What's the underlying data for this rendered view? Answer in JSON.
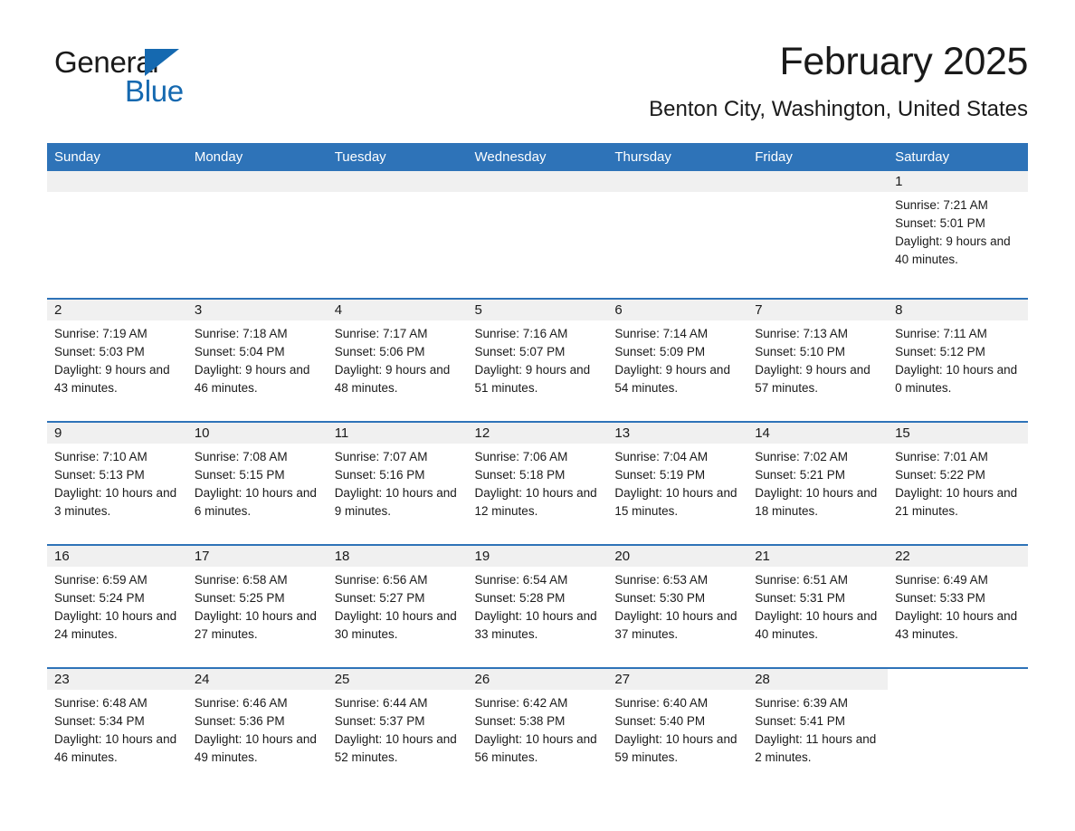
{
  "logo": {
    "word1": "General",
    "word2": "Blue",
    "triangle_color": "#1569b0",
    "text_color": "#1a1a1a"
  },
  "header": {
    "title": "February 2025",
    "location": "Benton City, Washington, United States"
  },
  "theme": {
    "header_blue": "#2e73b8",
    "day_band_gray": "#f0f0f0",
    "text": "#1a1a1a"
  },
  "weekday_headers": [
    "Sunday",
    "Monday",
    "Tuesday",
    "Wednesday",
    "Thursday",
    "Friday",
    "Saturday"
  ],
  "weeks": [
    [
      {
        "day": "",
        "sunrise": "",
        "sunset": "",
        "daylight": "",
        "blank": true
      },
      {
        "day": "",
        "sunrise": "",
        "sunset": "",
        "daylight": "",
        "blank": true
      },
      {
        "day": "",
        "sunrise": "",
        "sunset": "",
        "daylight": "",
        "blank": true
      },
      {
        "day": "",
        "sunrise": "",
        "sunset": "",
        "daylight": "",
        "blank": true
      },
      {
        "day": "",
        "sunrise": "",
        "sunset": "",
        "daylight": "",
        "blank": true
      },
      {
        "day": "",
        "sunrise": "",
        "sunset": "",
        "daylight": "",
        "blank": true
      },
      {
        "day": "1",
        "sunrise": "Sunrise: 7:21 AM",
        "sunset": "Sunset: 5:01 PM",
        "daylight": "Daylight: 9 hours and 40 minutes.",
        "blank": false
      }
    ],
    [
      {
        "day": "2",
        "sunrise": "Sunrise: 7:19 AM",
        "sunset": "Sunset: 5:03 PM",
        "daylight": "Daylight: 9 hours and 43 minutes.",
        "blank": false
      },
      {
        "day": "3",
        "sunrise": "Sunrise: 7:18 AM",
        "sunset": "Sunset: 5:04 PM",
        "daylight": "Daylight: 9 hours and 46 minutes.",
        "blank": false
      },
      {
        "day": "4",
        "sunrise": "Sunrise: 7:17 AM",
        "sunset": "Sunset: 5:06 PM",
        "daylight": "Daylight: 9 hours and 48 minutes.",
        "blank": false
      },
      {
        "day": "5",
        "sunrise": "Sunrise: 7:16 AM",
        "sunset": "Sunset: 5:07 PM",
        "daylight": "Daylight: 9 hours and 51 minutes.",
        "blank": false
      },
      {
        "day": "6",
        "sunrise": "Sunrise: 7:14 AM",
        "sunset": "Sunset: 5:09 PM",
        "daylight": "Daylight: 9 hours and 54 minutes.",
        "blank": false
      },
      {
        "day": "7",
        "sunrise": "Sunrise: 7:13 AM",
        "sunset": "Sunset: 5:10 PM",
        "daylight": "Daylight: 9 hours and 57 minutes.",
        "blank": false
      },
      {
        "day": "8",
        "sunrise": "Sunrise: 7:11 AM",
        "sunset": "Sunset: 5:12 PM",
        "daylight": "Daylight: 10 hours and 0 minutes.",
        "blank": false
      }
    ],
    [
      {
        "day": "9",
        "sunrise": "Sunrise: 7:10 AM",
        "sunset": "Sunset: 5:13 PM",
        "daylight": "Daylight: 10 hours and 3 minutes.",
        "blank": false
      },
      {
        "day": "10",
        "sunrise": "Sunrise: 7:08 AM",
        "sunset": "Sunset: 5:15 PM",
        "daylight": "Daylight: 10 hours and 6 minutes.",
        "blank": false
      },
      {
        "day": "11",
        "sunrise": "Sunrise: 7:07 AM",
        "sunset": "Sunset: 5:16 PM",
        "daylight": "Daylight: 10 hours and 9 minutes.",
        "blank": false
      },
      {
        "day": "12",
        "sunrise": "Sunrise: 7:06 AM",
        "sunset": "Sunset: 5:18 PM",
        "daylight": "Daylight: 10 hours and 12 minutes.",
        "blank": false
      },
      {
        "day": "13",
        "sunrise": "Sunrise: 7:04 AM",
        "sunset": "Sunset: 5:19 PM",
        "daylight": "Daylight: 10 hours and 15 minutes.",
        "blank": false
      },
      {
        "day": "14",
        "sunrise": "Sunrise: 7:02 AM",
        "sunset": "Sunset: 5:21 PM",
        "daylight": "Daylight: 10 hours and 18 minutes.",
        "blank": false
      },
      {
        "day": "15",
        "sunrise": "Sunrise: 7:01 AM",
        "sunset": "Sunset: 5:22 PM",
        "daylight": "Daylight: 10 hours and 21 minutes.",
        "blank": false
      }
    ],
    [
      {
        "day": "16",
        "sunrise": "Sunrise: 6:59 AM",
        "sunset": "Sunset: 5:24 PM",
        "daylight": "Daylight: 10 hours and 24 minutes.",
        "blank": false
      },
      {
        "day": "17",
        "sunrise": "Sunrise: 6:58 AM",
        "sunset": "Sunset: 5:25 PM",
        "daylight": "Daylight: 10 hours and 27 minutes.",
        "blank": false
      },
      {
        "day": "18",
        "sunrise": "Sunrise: 6:56 AM",
        "sunset": "Sunset: 5:27 PM",
        "daylight": "Daylight: 10 hours and 30 minutes.",
        "blank": false
      },
      {
        "day": "19",
        "sunrise": "Sunrise: 6:54 AM",
        "sunset": "Sunset: 5:28 PM",
        "daylight": "Daylight: 10 hours and 33 minutes.",
        "blank": false
      },
      {
        "day": "20",
        "sunrise": "Sunrise: 6:53 AM",
        "sunset": "Sunset: 5:30 PM",
        "daylight": "Daylight: 10 hours and 37 minutes.",
        "blank": false
      },
      {
        "day": "21",
        "sunrise": "Sunrise: 6:51 AM",
        "sunset": "Sunset: 5:31 PM",
        "daylight": "Daylight: 10 hours and 40 minutes.",
        "blank": false
      },
      {
        "day": "22",
        "sunrise": "Sunrise: 6:49 AM",
        "sunset": "Sunset: 5:33 PM",
        "daylight": "Daylight: 10 hours and 43 minutes.",
        "blank": false
      }
    ],
    [
      {
        "day": "23",
        "sunrise": "Sunrise: 6:48 AM",
        "sunset": "Sunset: 5:34 PM",
        "daylight": "Daylight: 10 hours and 46 minutes.",
        "blank": false
      },
      {
        "day": "24",
        "sunrise": "Sunrise: 6:46 AM",
        "sunset": "Sunset: 5:36 PM",
        "daylight": "Daylight: 10 hours and 49 minutes.",
        "blank": false
      },
      {
        "day": "25",
        "sunrise": "Sunrise: 6:44 AM",
        "sunset": "Sunset: 5:37 PM",
        "daylight": "Daylight: 10 hours and 52 minutes.",
        "blank": false
      },
      {
        "day": "26",
        "sunrise": "Sunrise: 6:42 AM",
        "sunset": "Sunset: 5:38 PM",
        "daylight": "Daylight: 10 hours and 56 minutes.",
        "blank": false
      },
      {
        "day": "27",
        "sunrise": "Sunrise: 6:40 AM",
        "sunset": "Sunset: 5:40 PM",
        "daylight": "Daylight: 10 hours and 59 minutes.",
        "blank": false
      },
      {
        "day": "28",
        "sunrise": "Sunrise: 6:39 AM",
        "sunset": "Sunset: 5:41 PM",
        "daylight": "Daylight: 11 hours and 2 minutes.",
        "blank": false
      },
      {
        "day": "",
        "sunrise": "",
        "sunset": "",
        "daylight": "",
        "blank": true,
        "nofill": true
      }
    ]
  ]
}
